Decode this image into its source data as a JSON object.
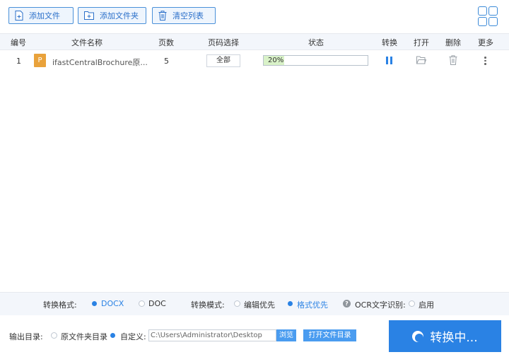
{
  "toolbar": {
    "add_file": "添加文件",
    "add_folder": "添加文件夹",
    "clear_list": "清空列表"
  },
  "table": {
    "headers": {
      "index": "编号",
      "name": "文件名称",
      "pages": "页数",
      "page_select": "页码选择",
      "status": "状态",
      "convert": "转换",
      "open": "打开",
      "delete": "删除",
      "more": "更多"
    },
    "rows": [
      {
        "index": "1",
        "file_icon_letter": "P",
        "name": "ifastCentralBrochure原...",
        "pages": "5",
        "page_select": "全部",
        "progress_text": "20%",
        "progress": 0.2
      }
    ]
  },
  "settings": {
    "format_label": "转换格式:",
    "format_options": [
      "DOCX",
      "DOC"
    ],
    "format_selected": "DOCX",
    "mode_label": "转换模式:",
    "mode_options": [
      "编辑优先",
      "格式优先"
    ],
    "mode_selected": "格式优先",
    "ocr_label": "OCR文字识别:",
    "ocr_option": "启用"
  },
  "output": {
    "label": "输出目录:",
    "option_source": "原文件夹目录",
    "option_custom": "自定义:",
    "path": "C:\\Users\\Administrator\\Desktop",
    "browse": "浏览",
    "open_dir": "打开文件目录",
    "convert_button": "转换中..."
  },
  "colors": {
    "accent": "#2a82e4",
    "progress_fill": "#d9f2c8",
    "header_bg": "#f3f6fb",
    "ppt_icon": "#e9a23b"
  }
}
